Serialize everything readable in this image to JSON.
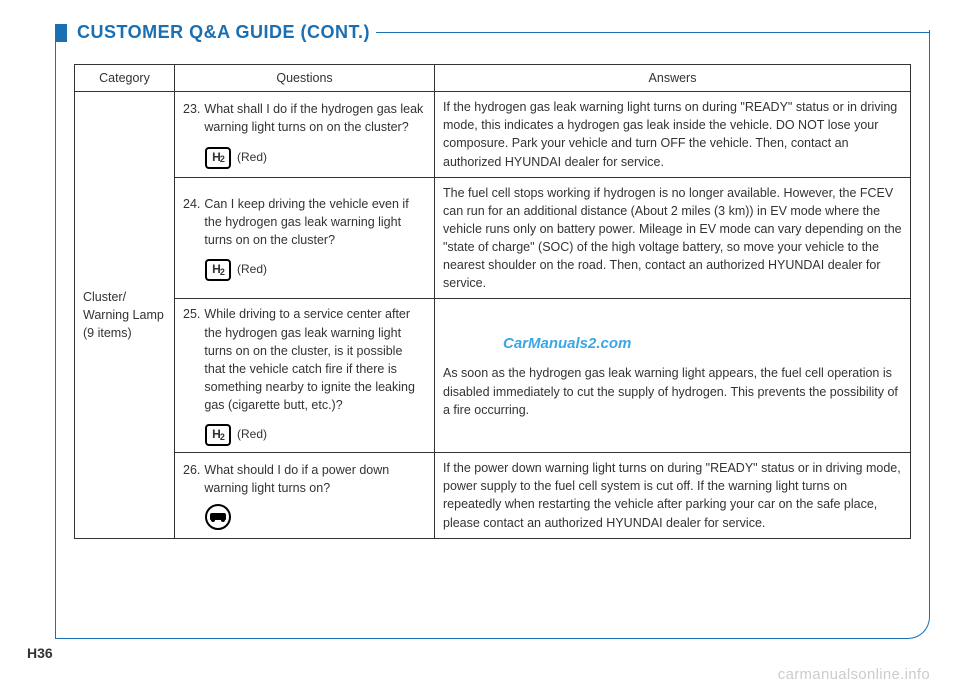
{
  "heading": "CUSTOMER Q&A GUIDE (CONT.)",
  "page_number": "H36",
  "watermark_center": "CarManuals2.com",
  "watermark_footer": "carmanualsonline.info",
  "table": {
    "headers": {
      "category": "Category",
      "questions": "Questions",
      "answers": "Answers"
    },
    "category": "Cluster/\nWarning Lamp\n(9 items)",
    "rows": [
      {
        "num": "23.",
        "question": "What shall I do if the hydrogen gas leak warning light turns on on the cluster?",
        "icon_type": "h2",
        "icon_label": "(Red)",
        "answer": "If the hydrogen gas leak warning light turns on during \"READY\" status or in driving mode, this indicates a hydrogen gas leak inside the vehicle. DO NOT lose your composure. Park your vehicle and turn OFF the vehicle. Then, contact an authorized HYUNDAI dealer for service."
      },
      {
        "num": "24.",
        "question": "Can I keep driving the vehicle even if the hydrogen gas leak warning light turns on on the cluster?",
        "icon_type": "h2",
        "icon_label": "(Red)",
        "answer": "The fuel cell stops working if hydrogen is no longer available. However, the FCEV can run for an additional distance (About 2 miles (3 km)) in EV mode where the vehicle runs only on battery power. Mileage in EV mode can vary depending on the \"state of charge\" (SOC) of the high voltage battery, so move your vehicle to the nearest shoulder on the road. Then, contact an authorized HYUNDAI dealer for service."
      },
      {
        "num": "25.",
        "question": "While driving to a service center after the hydrogen gas leak warning light turns on on the cluster, is it possible that the vehicle catch fire if there is something nearby to ignite the leaking gas (cigarette butt, etc.)?",
        "icon_type": "h2",
        "icon_label": "(Red)",
        "answer": "As soon as the hydrogen gas leak warning light appears, the fuel cell operation is disabled immediately to cut the supply of hydrogen. This prevents the possibility of a fire occurring.",
        "show_watermark": true
      },
      {
        "num": "26.",
        "question": "What should I do if a power down warning light turns on?",
        "icon_type": "powerdown",
        "icon_label": "",
        "answer": "If the power down warning light turns on during \"READY\" status or in driving mode, power supply to the fuel cell system is cut off. If the warning light turns on repeatedly when restarting the vehicle after parking your car on the safe place, please contact an authorized HYUNDAI dealer for service."
      }
    ]
  }
}
